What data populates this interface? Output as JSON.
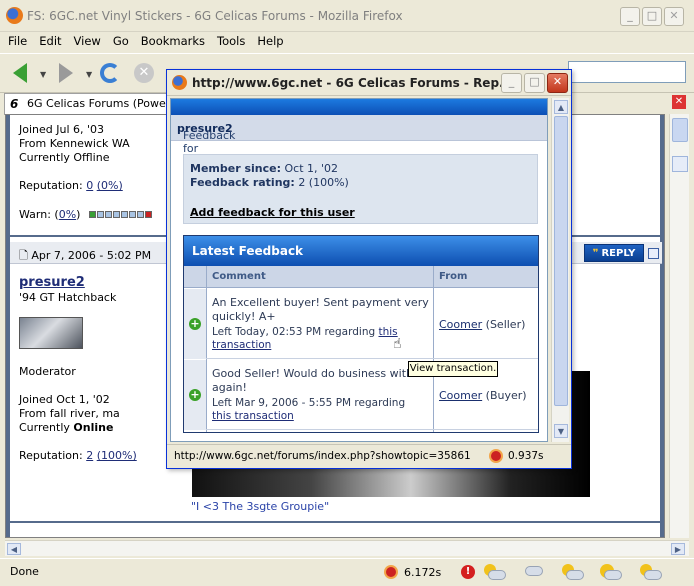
{
  "window": {
    "title": "FS: 6GC.net Vinyl Stickers - 6G Celicas Forums - Mozilla Firefox",
    "min": "_",
    "max": "□",
    "close": "✕"
  },
  "menu": [
    "File",
    "Edit",
    "View",
    "Go",
    "Bookmarks",
    "Tools",
    "Help"
  ],
  "tab": {
    "label": "6G Celicas Forums (Powered",
    "icon_text": "6",
    "close": "✕"
  },
  "page": {
    "user1": {
      "joined": "Joined Jul 6, '03",
      "from": "From Kennewick WA",
      "status": "Currently Offline",
      "reputation_label": "Reputation:",
      "reputation_value": "0",
      "reputation_pct": "(0%)",
      "warn_label": "Warn: (",
      "warn_pct": "0%",
      "warn_end": ")"
    },
    "post": {
      "date": "Apr 7, 2006 - 5:02 PM",
      "reply_label": "REPLY",
      "username": "presure2",
      "car": "'94 GT Hatchback",
      "role": "Moderator",
      "joined": "Joined Oct 1, '02",
      "from": "From fall river, ma",
      "status_prefix": "Currently ",
      "status_value": "Online",
      "reputation_label": "Reputation:",
      "reputation_value": "2",
      "reputation_pct": "(100%)",
      "signature": "\"I <3 The 3sgte Groupie\""
    }
  },
  "status": {
    "text": "Done",
    "timer": "6.172s"
  },
  "popup": {
    "title": "http://www.6gc.net - 6G Celicas Forums - Rep...",
    "feedback_for_label": "Feedback for",
    "feedback_for_user": "presure2",
    "member_since_label": "Member since:",
    "member_since_value": "Oct 1, '02",
    "feedback_rating_label": "Feedback rating:",
    "feedback_rating_value": "2 (100%)",
    "add_feedback": "Add feedback for this user",
    "latest_title": "Latest Feedback",
    "col_comment": "Comment",
    "col_from": "From",
    "rows": [
      {
        "comment": "An Excellent buyer! Sent payment very quickly! A+",
        "left_prefix": "Left Today, 02:53 PM regarding ",
        "link_a": "this",
        "link_b": "transaction",
        "user": "Coomer",
        "role": "(Seller)"
      },
      {
        "comment": "Good Seller! Would do business with again!",
        "left_prefix": "Left Mar 9, 2006 - 5:55 PM regarding",
        "link_a": "this transaction",
        "link_b": "",
        "user": "Coomer",
        "role": "(Buyer)"
      }
    ],
    "status_url": "http://www.6gc.net/forums/index.php?showtopic=35861",
    "status_timer": "0.937s",
    "tooltip": "View transaction."
  }
}
